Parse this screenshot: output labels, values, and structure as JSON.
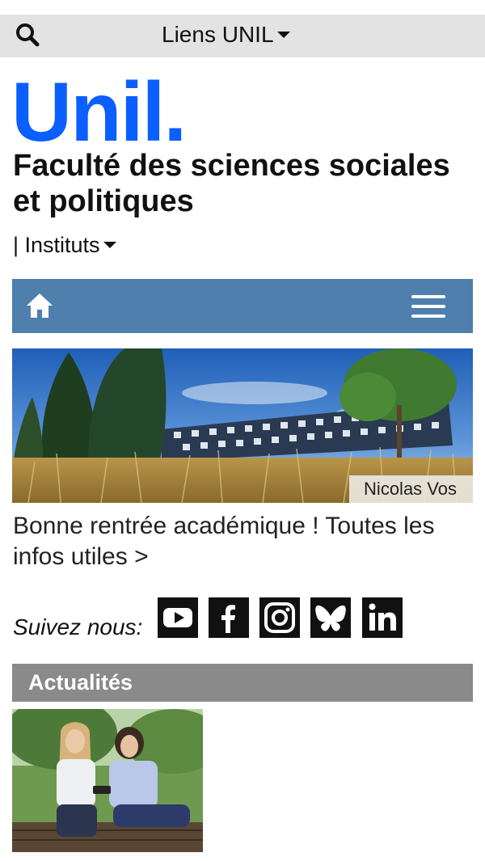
{
  "topbar": {
    "links_label": "Liens UNIL"
  },
  "brand": {
    "logo_text": "Unil.",
    "logo_color": "#0b5fff",
    "faculty_name": "Faculté des sciences sociales et politiques",
    "instituts_label": "| Instituts"
  },
  "navbar": {
    "color": "#4f7fad"
  },
  "hero": {
    "photo_credit": "Nicolas Vos",
    "headline": "Bonne rentrée académique ! Toutes les infos utiles >"
  },
  "social": {
    "label": "Suivez nous:",
    "networks": [
      "youtube-icon",
      "facebook-icon",
      "instagram-icon",
      "bluesky-icon",
      "linkedin-icon"
    ]
  },
  "news": {
    "section_title": "Actualités",
    "bar_color": "#8a8a8a"
  }
}
